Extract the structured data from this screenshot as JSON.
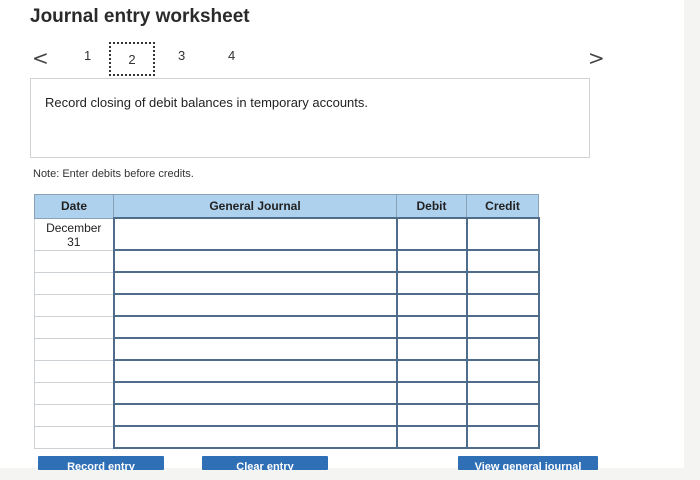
{
  "title": "Journal entry worksheet",
  "nav": {
    "prev_glyph": "<",
    "next_glyph": ">",
    "steps": [
      "1",
      "2",
      "3",
      "4"
    ],
    "active_step": "2"
  },
  "instruction": "Record closing of debit balances in temporary accounts.",
  "note": "Note: Enter debits before credits.",
  "table": {
    "headers": {
      "date": "Date",
      "journal": "General Journal",
      "debit": "Debit",
      "credit": "Credit"
    },
    "first_row_date_line1": "December",
    "first_row_date_line2": "31"
  },
  "buttons": {
    "record": "Record entry",
    "clear": "Clear entry",
    "view": "View general journal"
  },
  "colors": {
    "header_bg": "#aed1ee",
    "button_bg": "#2f6fb5",
    "input_border": "#4f6d8a"
  }
}
